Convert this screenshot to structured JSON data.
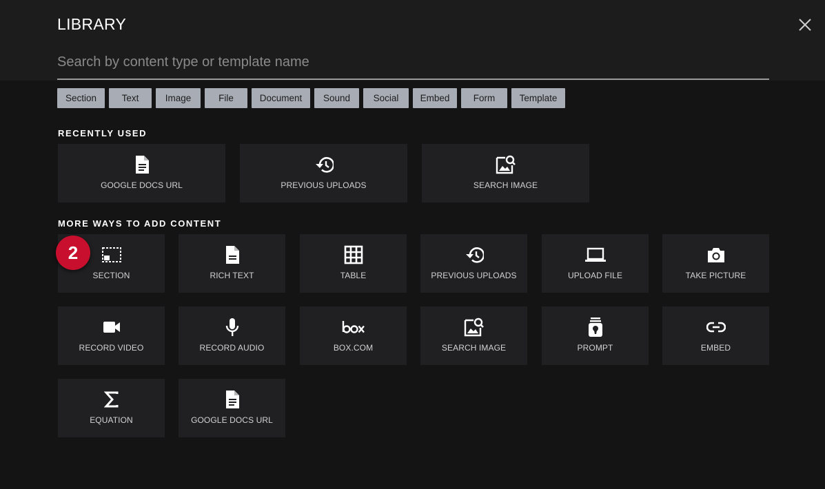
{
  "header": {
    "title": "LIBRARY",
    "search_placeholder": "Search by content type or template name"
  },
  "filters": [
    "Section",
    "Text",
    "Image",
    "File",
    "Document",
    "Sound",
    "Social",
    "Embed",
    "Form",
    "Template"
  ],
  "recently_used": {
    "label": "RECENTLY USED",
    "items": [
      {
        "label": "GOOGLE DOCS URL",
        "icon": "document-icon"
      },
      {
        "label": "PREVIOUS UPLOADS",
        "icon": "history-icon"
      },
      {
        "label": "SEARCH IMAGE",
        "icon": "image-search-icon"
      }
    ]
  },
  "more_ways": {
    "label": "MORE WAYS TO ADD CONTENT",
    "items": [
      {
        "label": "SECTION",
        "icon": "section-icon"
      },
      {
        "label": "RICH TEXT",
        "icon": "document-icon"
      },
      {
        "label": "TABLE",
        "icon": "grid-icon"
      },
      {
        "label": "PREVIOUS UPLOADS",
        "icon": "history-icon"
      },
      {
        "label": "UPLOAD FILE",
        "icon": "laptop-icon"
      },
      {
        "label": "TAKE PICTURE",
        "icon": "camera-icon"
      },
      {
        "label": "RECORD VIDEO",
        "icon": "video-camera-icon"
      },
      {
        "label": "RECORD AUDIO",
        "icon": "microphone-icon"
      },
      {
        "label": "BOX.COM",
        "icon": "box-logo-icon"
      },
      {
        "label": "SEARCH IMAGE",
        "icon": "image-search-icon"
      },
      {
        "label": "PROMPT",
        "icon": "prompt-icon"
      },
      {
        "label": "EMBED",
        "icon": "link-icon"
      },
      {
        "label": "EQUATION",
        "icon": "sigma-icon"
      },
      {
        "label": "GOOGLE DOCS URL",
        "icon": "document-icon"
      }
    ]
  },
  "badge": {
    "number": "2",
    "color": "#c8102e"
  },
  "colors": {
    "background": "#141414",
    "tile": "#202022",
    "chip": "#a8adb5"
  }
}
